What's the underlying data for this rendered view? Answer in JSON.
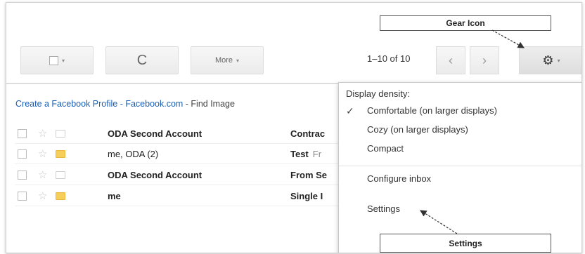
{
  "toolbar": {
    "select_caret": "▾",
    "refresh_icon": "refresh-icon",
    "refresh_glyph": "C",
    "more_label": "More",
    "more_caret": "▾",
    "pager": "1–10 of 10",
    "prev_glyph": "‹",
    "next_glyph": "›",
    "gear_icon": "gear-icon",
    "gear_glyph": "⚙",
    "gear_caret": "▾"
  },
  "ad": {
    "link": "Create a Facebook Profile - Facebook.com",
    "rest": " - Find Image"
  },
  "emails": [
    {
      "sender": "ODA Second Account",
      "subject": "Contrac",
      "snippet": "",
      "important": false,
      "read": false
    },
    {
      "sender": "me, ODA (2)",
      "subject": "Test",
      "snippet": "Fr",
      "important": true,
      "read": true
    },
    {
      "sender": "ODA Second Account",
      "subject": "From Se",
      "snippet": "",
      "important": false,
      "read": false
    },
    {
      "sender": "me",
      "subject": "Single I",
      "snippet": "",
      "important": true,
      "read": false
    }
  ],
  "menu": {
    "heading": "Display density:",
    "checkmark": "✓",
    "items": [
      "Comfortable (on larger displays)",
      "Cozy (on larger displays)",
      "Compact",
      "Configure inbox",
      "Settings"
    ]
  },
  "callouts": {
    "gear": "Gear Icon",
    "settings": "Settings"
  },
  "colors": {
    "important_label": "#f6cf5a",
    "ad_link": "#1a5fb4"
  }
}
